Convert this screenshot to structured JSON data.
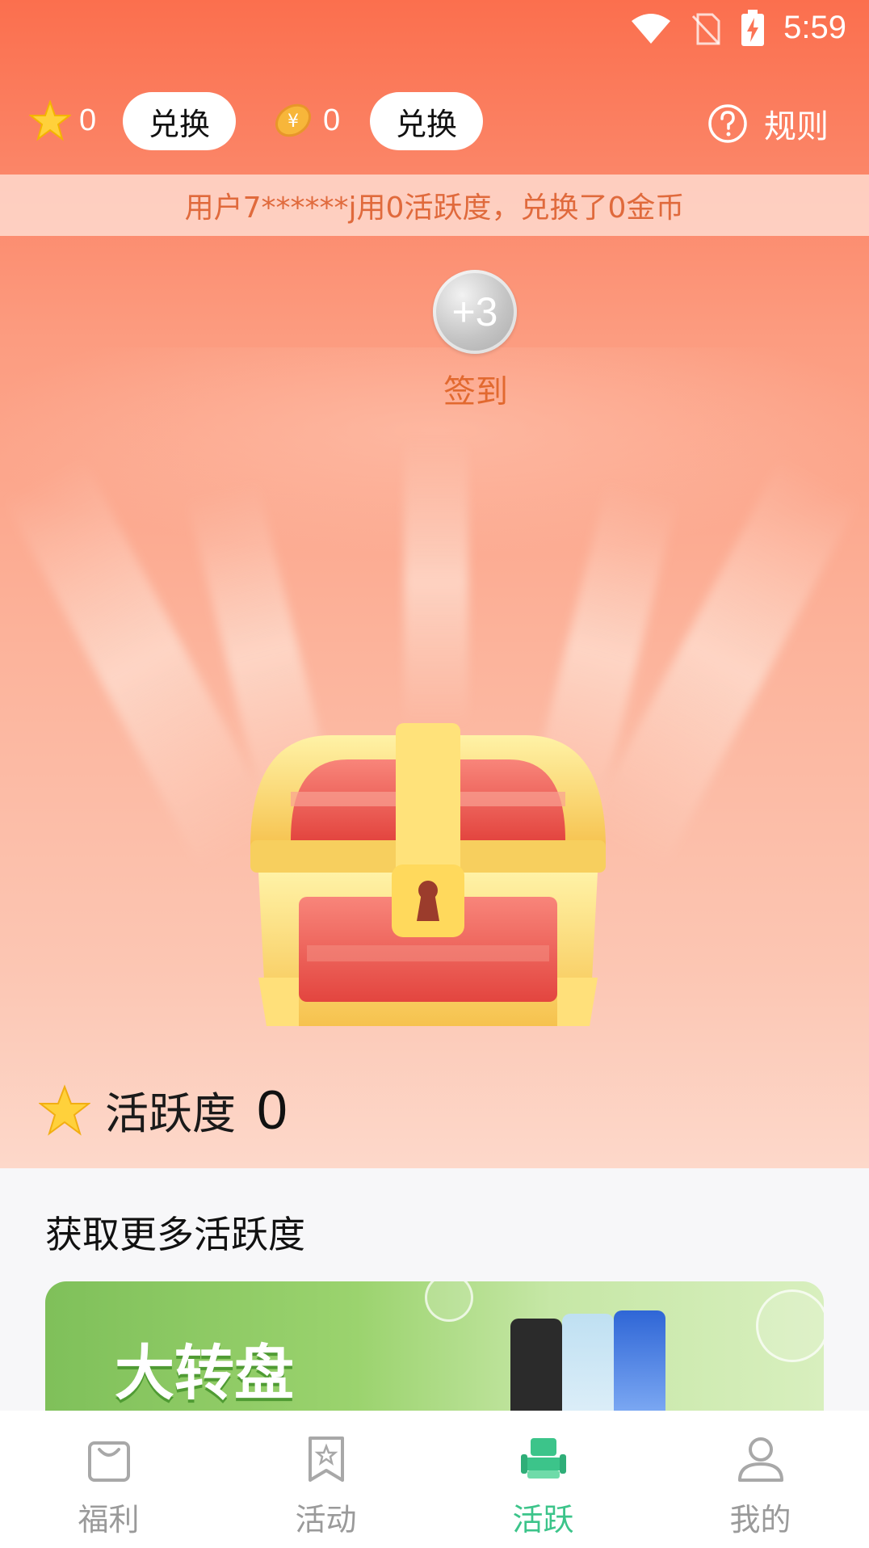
{
  "status_bar": {
    "time": "5:59"
  },
  "header": {
    "stars_count": "0",
    "exchange_label_1": "兑换",
    "coins_count": "0",
    "exchange_label_2": "兑换",
    "rules_label": "规则"
  },
  "marquee": {
    "text": "用户7******j用0活跃度，兑换了0金币"
  },
  "checkin": {
    "reward": "+3",
    "label": "签到"
  },
  "activity": {
    "label": "活跃度",
    "value": "0"
  },
  "more": {
    "title": "获取更多活跃度",
    "banner_title": "大转盘"
  },
  "bottom_nav": {
    "items": [
      {
        "label": "福利",
        "icon": "bag-icon"
      },
      {
        "label": "活动",
        "icon": "bookmark-star-icon"
      },
      {
        "label": "活跃",
        "icon": "chair-icon"
      },
      {
        "label": "我的",
        "icon": "user-icon"
      }
    ],
    "active_index": 2
  },
  "colors": {
    "brand_orange": "#fb6f4e",
    "active_green": "#3cc48a",
    "inactive_gray": "#9a9a9a"
  }
}
